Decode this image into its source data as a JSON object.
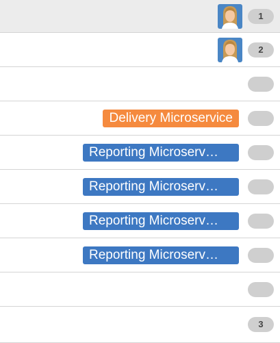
{
  "rows": [
    {
      "has_avatar": true,
      "tag": null,
      "count": "1"
    },
    {
      "has_avatar": true,
      "tag": null,
      "count": "2"
    },
    {
      "has_avatar": false,
      "tag": null,
      "count": ""
    },
    {
      "has_avatar": false,
      "tag": {
        "label": "Delivery Microservice",
        "color": "#f58a3e"
      },
      "count": ""
    },
    {
      "has_avatar": false,
      "tag": {
        "label": "Reporting Microserv…",
        "color": "#3d78c2"
      },
      "count": ""
    },
    {
      "has_avatar": false,
      "tag": {
        "label": "Reporting Microserv…",
        "color": "#3d78c2"
      },
      "count": ""
    },
    {
      "has_avatar": false,
      "tag": {
        "label": "Reporting Microserv…",
        "color": "#3d78c2"
      },
      "count": ""
    },
    {
      "has_avatar": false,
      "tag": {
        "label": "Reporting Microserv…",
        "color": "#3d78c2"
      },
      "count": ""
    },
    {
      "has_avatar": false,
      "tag": null,
      "count": ""
    },
    {
      "has_avatar": false,
      "tag": null,
      "count": "3"
    }
  ],
  "icons": {
    "avatar": "user-avatar-icon"
  },
  "colors": {
    "first_row_bg": "#ececec",
    "count_pill": "#cfcfcf",
    "divider": "#d4d4d4"
  }
}
